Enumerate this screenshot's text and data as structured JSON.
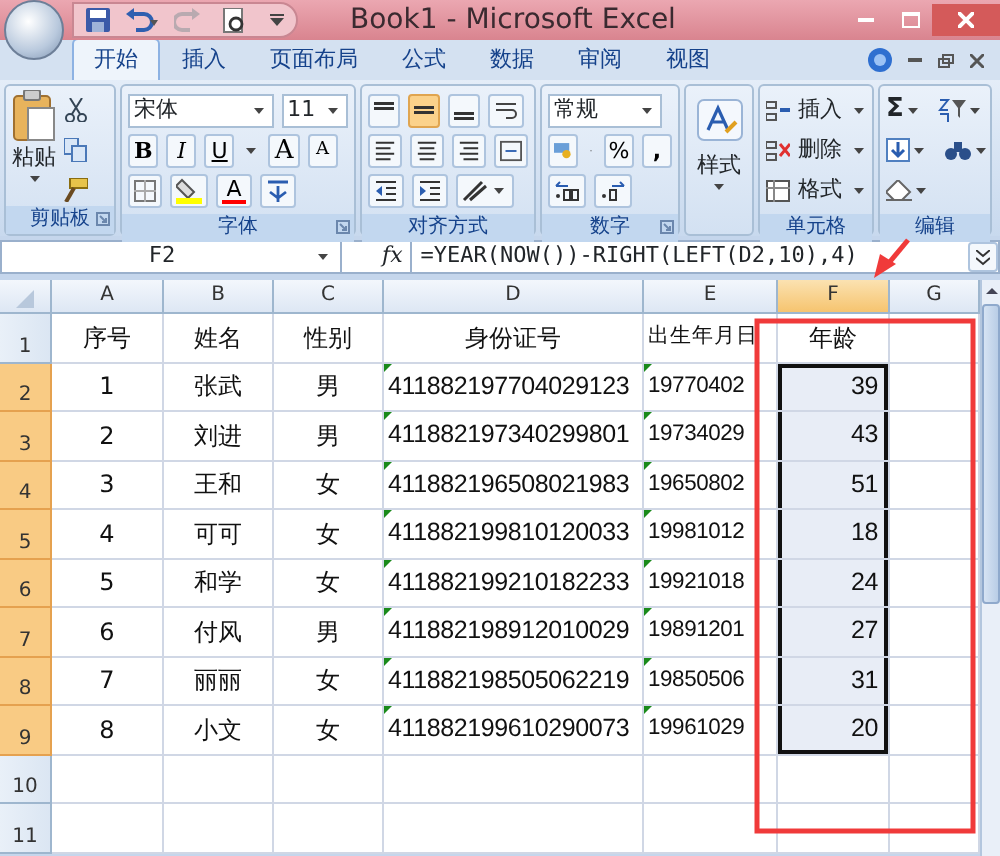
{
  "window": {
    "title": "Book1 - Microsoft Excel"
  },
  "tabs": [
    {
      "label": "开始",
      "selected": true
    },
    {
      "label": "插入",
      "selected": false
    },
    {
      "label": "页面布局",
      "selected": false
    },
    {
      "label": "公式",
      "selected": false
    },
    {
      "label": "数据",
      "selected": false
    },
    {
      "label": "审阅",
      "selected": false
    },
    {
      "label": "视图",
      "selected": false
    }
  ],
  "ribbon": [
    {
      "kind": "clipboard",
      "label": "剪贴板",
      "paste": "粘贴"
    },
    {
      "kind": "font",
      "label": "字体",
      "font_name": "宋体",
      "font_size": "11",
      "bold": "B",
      "italic": "I",
      "underline": "U",
      "grow": "A",
      "shrink": "A",
      "font_color": "A"
    },
    {
      "kind": "alignment",
      "label": "对齐方式",
      "vertical_align_buttons": [
        {
          "selected": false
        },
        {
          "selected": true
        },
        {
          "selected": false
        }
      ]
    },
    {
      "kind": "number",
      "label": "数字",
      "format": "常规",
      "percent": "%",
      "comma": ","
    },
    {
      "kind": "styles",
      "button": "样式"
    },
    {
      "kind": "cells",
      "label": "单元格",
      "items": [
        "插入",
        "删除",
        "格式"
      ]
    },
    {
      "kind": "editing",
      "label": "编辑",
      "sum": "Σ"
    }
  ],
  "formula_bar": {
    "name_box": "F2",
    "function_label": "fx",
    "formula": "=YEAR(NOW())-RIGHT(LEFT(D2,10),4)"
  },
  "columns": [
    {
      "label": "A",
      "selected": false
    },
    {
      "label": "B",
      "selected": false
    },
    {
      "label": "C",
      "selected": false
    },
    {
      "label": "D",
      "selected": false
    },
    {
      "label": "E",
      "selected": false
    },
    {
      "label": "F",
      "selected": true
    },
    {
      "label": "G",
      "selected": false
    }
  ],
  "rows": [
    {
      "header": "1",
      "selected": false,
      "cells": [
        "序号",
        "姓名",
        "性别",
        "身份证号",
        "出生年月日",
        "年龄"
      ]
    },
    {
      "header": "2",
      "selected": true,
      "number_as_text": true,
      "cells": [
        "1",
        "张武",
        "男",
        "411882197704029123",
        "19770402",
        "39"
      ]
    },
    {
      "header": "3",
      "selected": true,
      "number_as_text": true,
      "cells": [
        "2",
        "刘进",
        "男",
        "411882197340299801",
        "19734029",
        "43"
      ]
    },
    {
      "header": "4",
      "selected": true,
      "number_as_text": true,
      "cells": [
        "3",
        "王和",
        "女",
        "411882196508021983",
        "19650802",
        "51"
      ]
    },
    {
      "header": "5",
      "selected": true,
      "number_as_text": true,
      "cells": [
        "4",
        "可可",
        "女",
        "411882199810120033",
        "19981012",
        "18"
      ]
    },
    {
      "header": "6",
      "selected": true,
      "number_as_text": true,
      "cells": [
        "5",
        "和学",
        "女",
        "411882199210182233",
        "19921018",
        "24"
      ]
    },
    {
      "header": "7",
      "selected": true,
      "number_as_text": true,
      "cells": [
        "6",
        "付风",
        "男",
        "411882198912010029",
        "19891201",
        "27"
      ]
    },
    {
      "header": "8",
      "selected": true,
      "number_as_text": true,
      "cells": [
        "7",
        "丽丽",
        "女",
        "411882198505062219",
        "19850506",
        "31"
      ]
    },
    {
      "header": "9",
      "selected": true,
      "number_as_text": true,
      "cells": [
        "8",
        "小文",
        "女",
        "411882199610290073",
        "19961029",
        "20"
      ]
    },
    {
      "header": "10",
      "selected": false,
      "cells": []
    },
    {
      "header": "11",
      "selected": false,
      "cells": []
    }
  ]
}
